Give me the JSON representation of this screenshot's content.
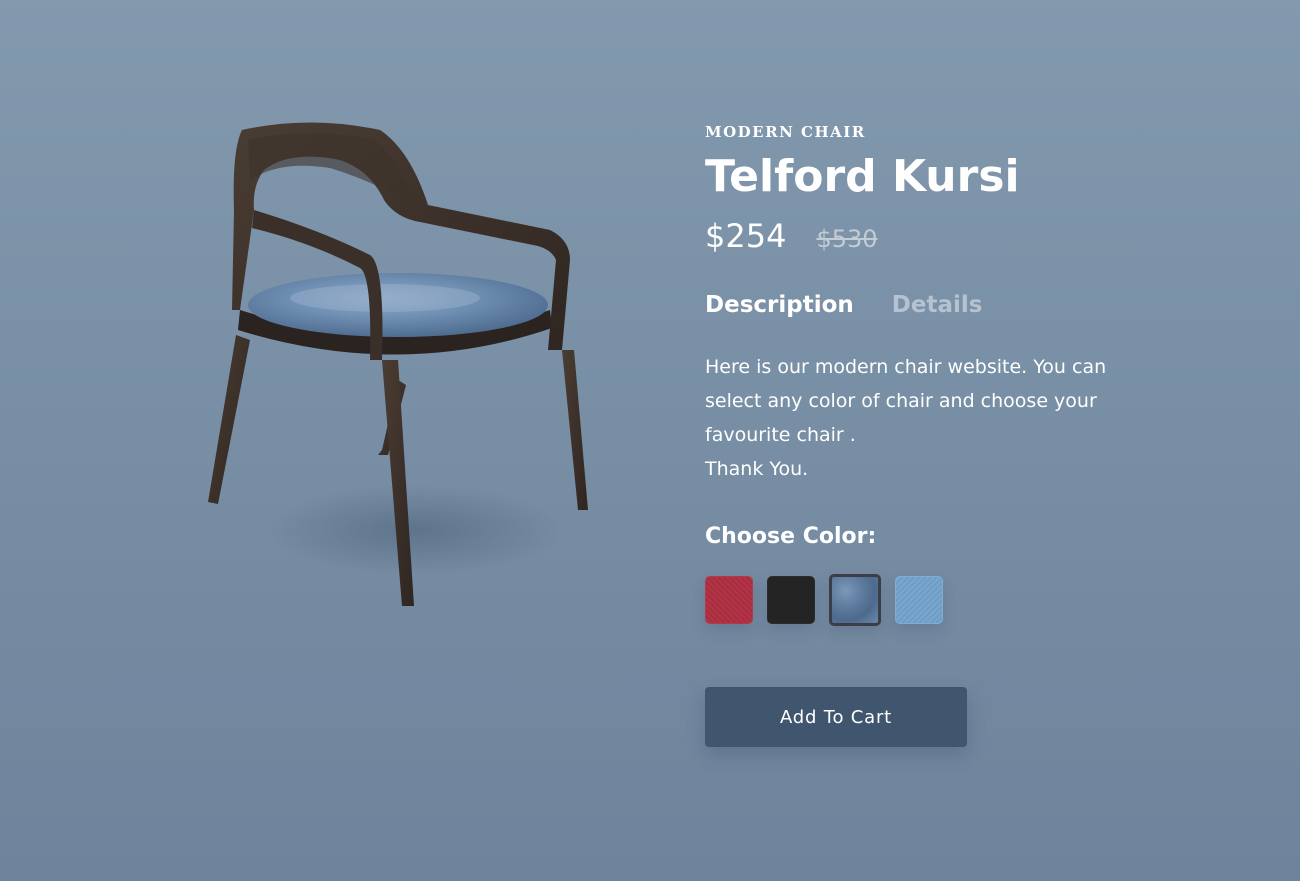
{
  "product": {
    "category": "MODERN CHAIR",
    "name": "Telford Kursi",
    "price": "$254",
    "original_price": "$530",
    "image_icon": "chair-image"
  },
  "tabs": [
    {
      "label": "Description",
      "active": true
    },
    {
      "label": "Details",
      "active": false
    }
  ],
  "description": {
    "lines": [
      "Here is our modern chair website. You can select any color of chair and choose your favourite chair .",
      "Thank You."
    ]
  },
  "colors": {
    "heading": "Choose Color:",
    "options": [
      {
        "name": "red",
        "hex": "#a82d3f",
        "selected": false
      },
      {
        "name": "black",
        "hex": "#242424",
        "selected": false
      },
      {
        "name": "blue",
        "hex": "#5f7d9f",
        "selected": true
      },
      {
        "name": "light-blue",
        "hex": "#75a2c9",
        "selected": false
      }
    ]
  },
  "cart": {
    "button_label": "Add To Cart"
  },
  "theme": {
    "background": "#7a91a7",
    "button": "#40566f",
    "inactive_tab": "#b6c2cf"
  }
}
